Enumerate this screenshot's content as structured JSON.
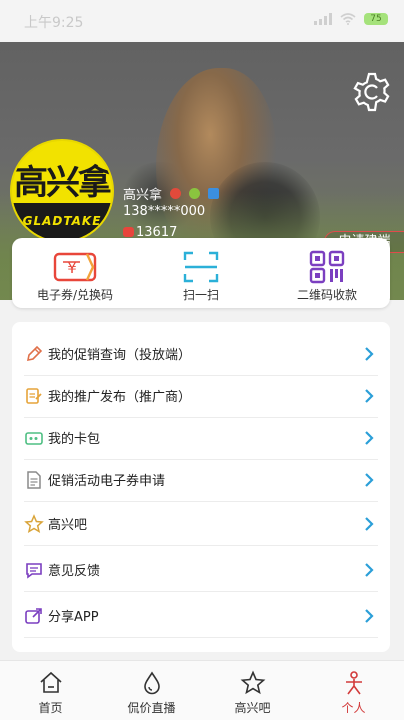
{
  "status_bar": {
    "time": "上午9:25",
    "battery": "75"
  },
  "header": {
    "settings_icon": "gear-icon",
    "avatar": {
      "logo_top": "高兴拿",
      "logo_bottom": "GLADTAKE"
    },
    "user": {
      "name": "高兴拿",
      "phone": "138*****000",
      "points": "13617"
    },
    "apply_button": "申请建端"
  },
  "quick_actions": [
    {
      "label": "电子券/兑换码",
      "icon": "coupon-icon",
      "color": "#e8463a"
    },
    {
      "label": "扫一扫",
      "icon": "scan-icon",
      "color": "#2bb0d8"
    },
    {
      "label": "二维码收款",
      "icon": "qrcode-icon",
      "color": "#7b3fc0"
    }
  ],
  "menu": [
    {
      "label": "我的促销查询（投放端）",
      "icon": "pencil-icon"
    },
    {
      "label": "我的推广发布（推广商）",
      "icon": "edit-document-icon"
    },
    {
      "label": "我的卡包",
      "icon": "card-icon"
    },
    {
      "label": "促销活动电子券申请",
      "icon": "document-icon"
    },
    {
      "label": "高兴吧",
      "icon": "star-icon"
    },
    {
      "label": "意见反馈",
      "icon": "feedback-icon"
    },
    {
      "label": "分享APP",
      "icon": "share-icon"
    }
  ],
  "tabs": [
    {
      "label": "首页",
      "icon": "home-icon",
      "active": false
    },
    {
      "label": "侃价直播",
      "icon": "drop-icon",
      "active": false
    },
    {
      "label": "高兴吧",
      "icon": "star-icon",
      "active": false
    },
    {
      "label": "个人",
      "icon": "person-icon",
      "active": true
    }
  ],
  "colors": {
    "accent": "#2b9fd8",
    "active_tab": "#d23a3a",
    "apply_border": "#e14b4b"
  }
}
